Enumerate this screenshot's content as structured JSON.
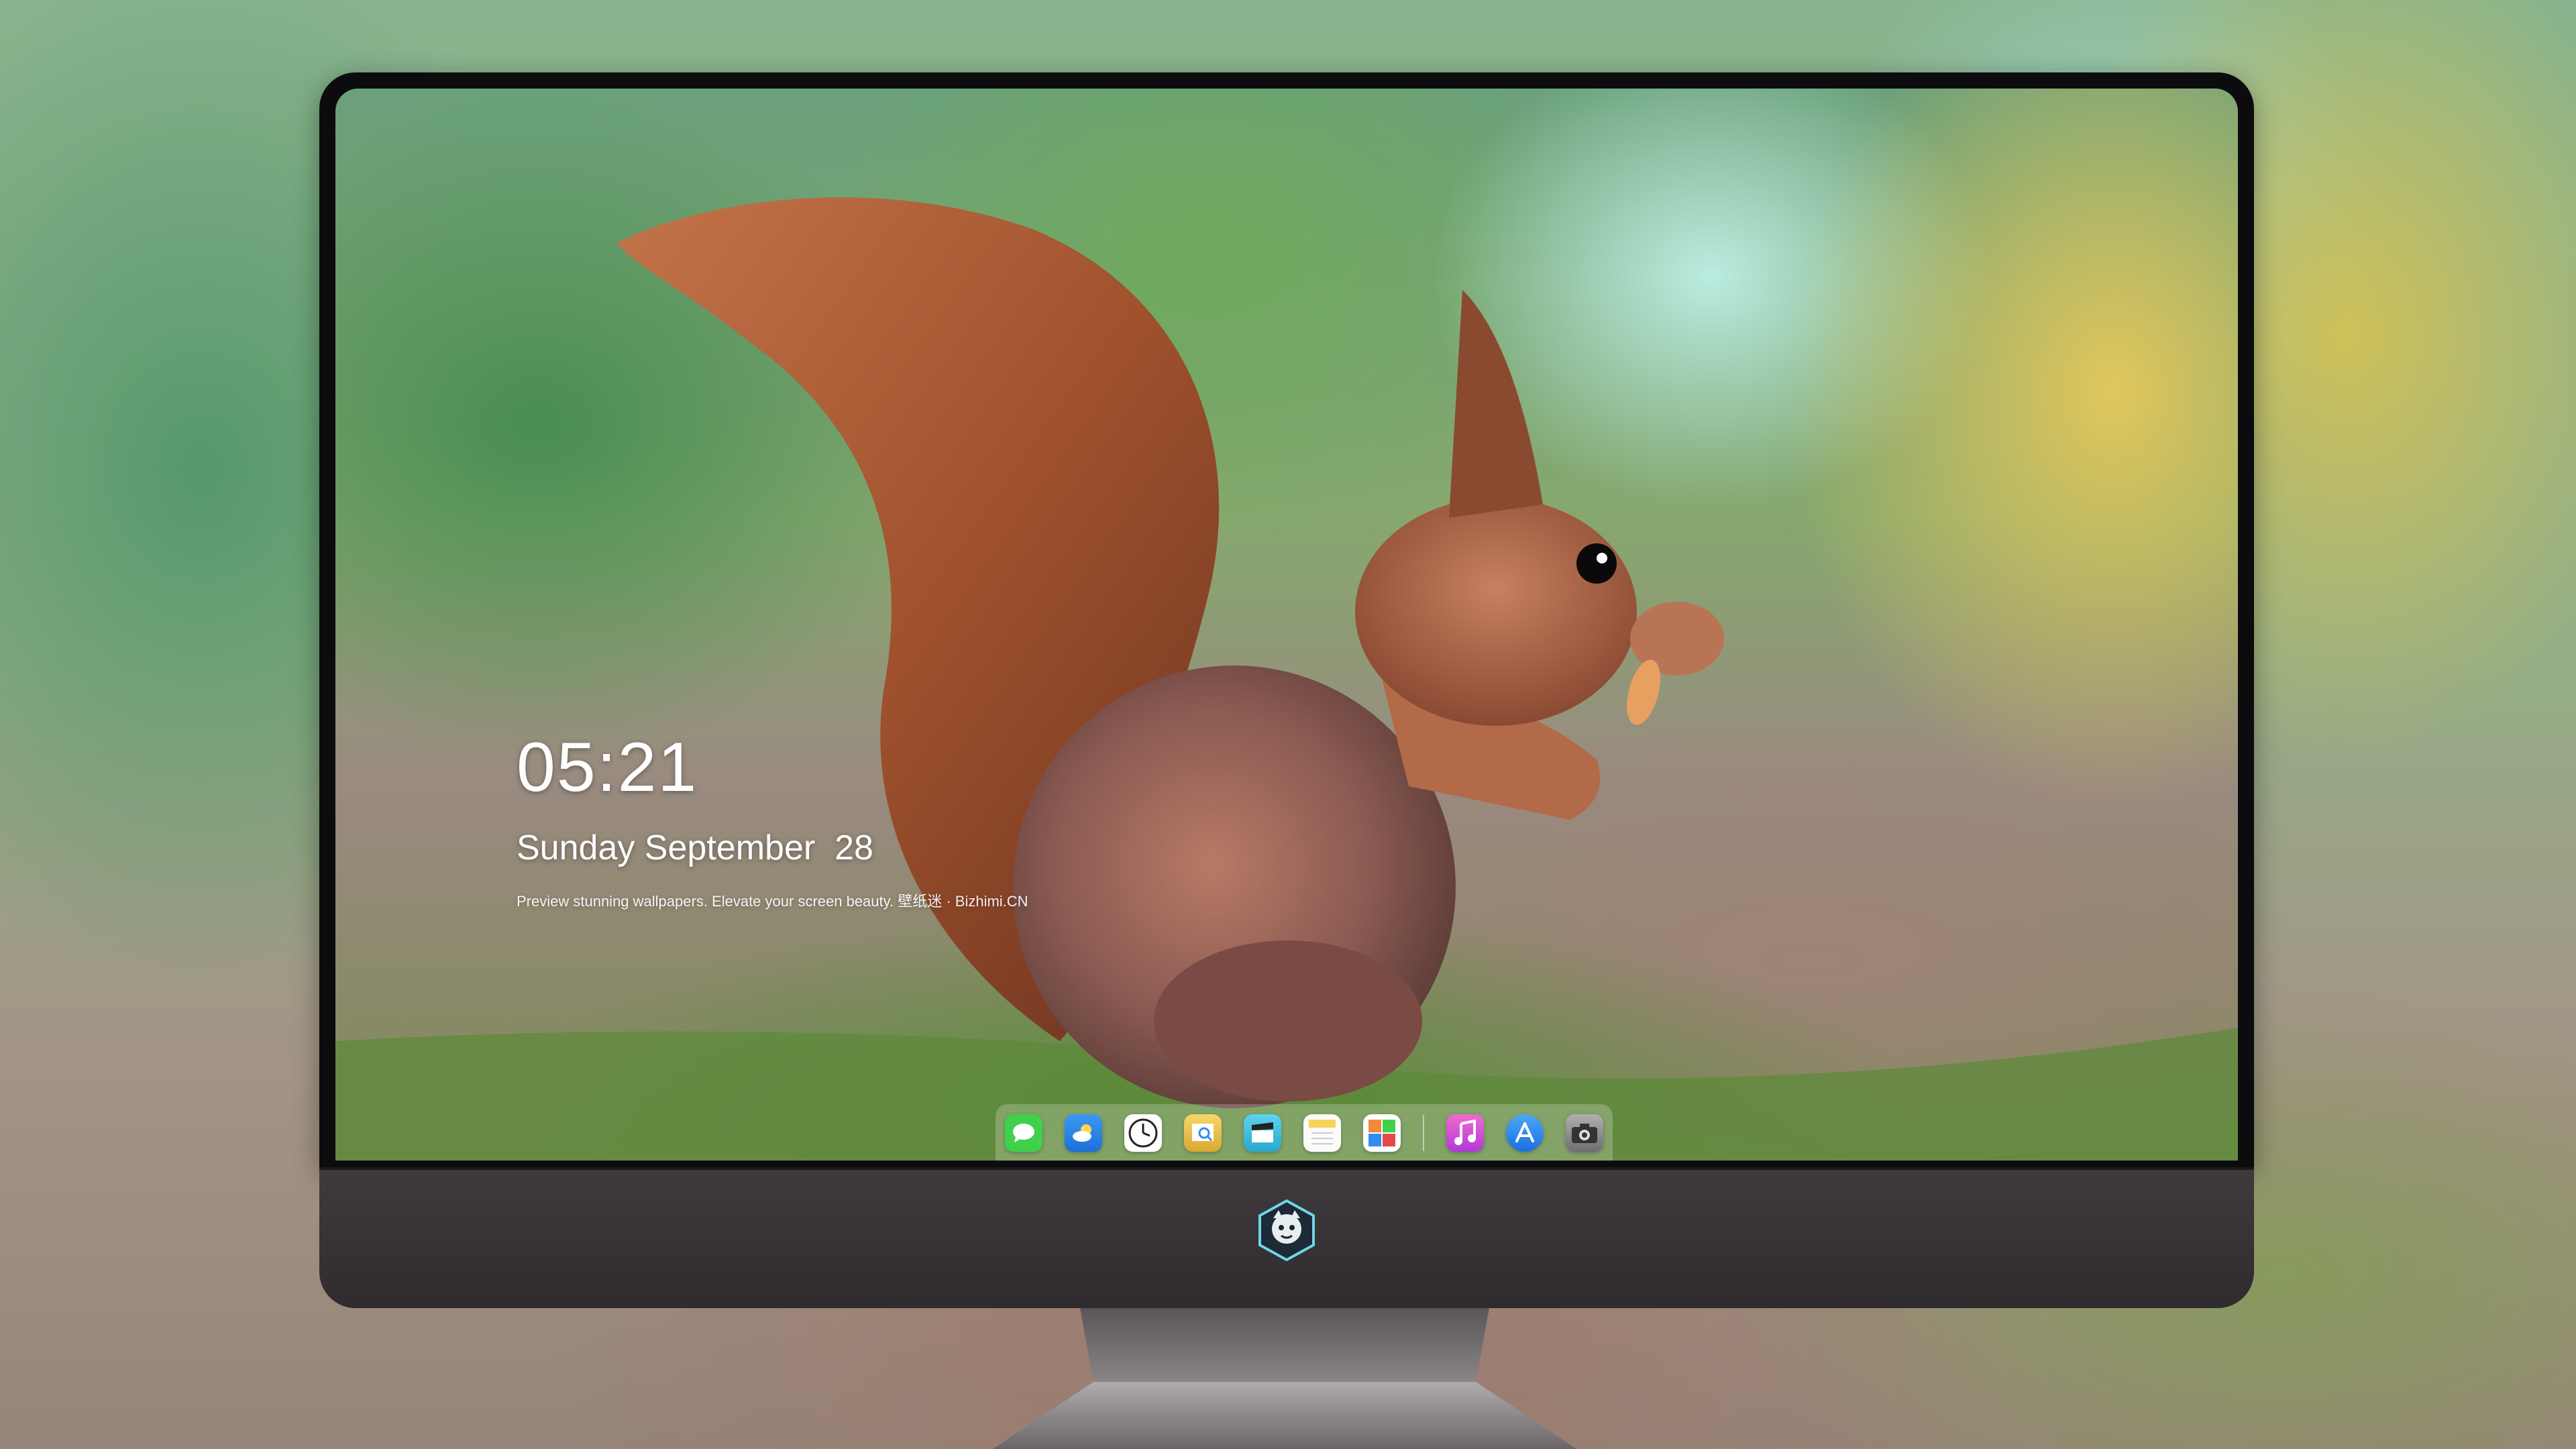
{
  "lockscreen": {
    "time": "05:21",
    "date": "Sunday September  28",
    "tagline": "Preview stunning wallpapers. Elevate your screen beauty. 壁纸迷 · Bizhimi.CN"
  },
  "dock": {
    "apps": [
      {
        "name": "Messages",
        "icon": "messages-icon",
        "color": "#3fd14b",
        "glyph": "💬"
      },
      {
        "name": "Weather",
        "icon": "weather-icon",
        "color": "#2f8ef0",
        "glyph": "☁"
      },
      {
        "name": "Clock",
        "icon": "clock-icon",
        "color": "#ffffff",
        "glyph": "🕑"
      },
      {
        "name": "Preview",
        "icon": "preview-icon",
        "color": "#e9c64a",
        "glyph": "🔍"
      },
      {
        "name": "Clapper",
        "icon": "clapperboard-icon",
        "color": "#47c7e6",
        "glyph": "🎬"
      },
      {
        "name": "Notes",
        "icon": "notes-icon",
        "color": "#f6d45a",
        "glyph": "▤"
      },
      {
        "name": "Photo Booth",
        "icon": "photo-booth-icon",
        "color": "#f08a3c",
        "glyph": "▦"
      },
      {
        "name": "Music",
        "icon": "music-icon",
        "color": "#e24ac0",
        "glyph": "♫"
      },
      {
        "name": "App Store",
        "icon": "app-store-icon",
        "color": "#2f8ef0",
        "glyph": "Ⓐ"
      },
      {
        "name": "Camera",
        "icon": "camera-icon",
        "color": "#9a9a9a",
        "glyph": "📷"
      }
    ]
  },
  "colors": {
    "bezel": "#0c0c0e",
    "chin": "#3e3a3d",
    "squirrel_fur": "#a05a3c"
  }
}
